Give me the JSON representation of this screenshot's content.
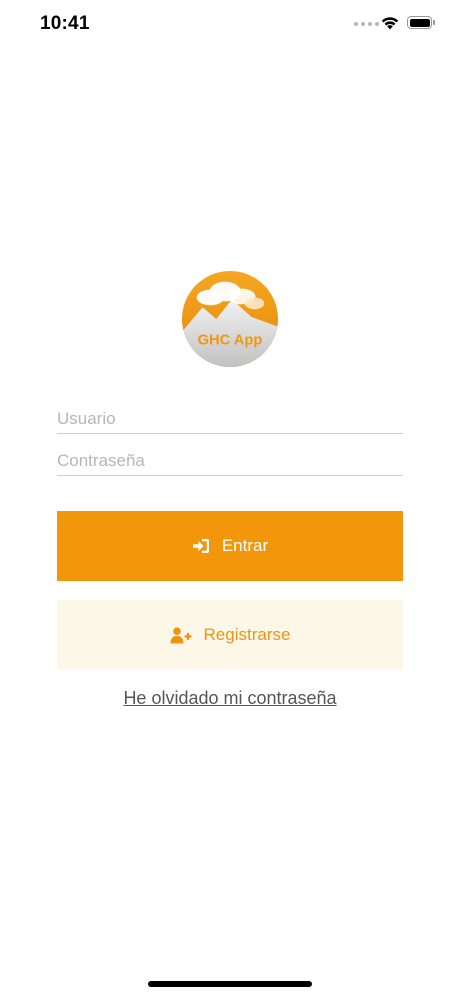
{
  "status_bar": {
    "time": "10:41",
    "signal_icon": "cellular-signal-icon",
    "wifi_icon": "wifi-icon",
    "battery_icon": "battery-icon"
  },
  "logo": {
    "text": "GHC App",
    "colors": {
      "orange": "#f2970c",
      "mountain": "#d9d9d9",
      "cloud": "#ffffff"
    }
  },
  "login_form": {
    "username_placeholder": "Usuario",
    "username_value": "",
    "password_placeholder": "Contraseña",
    "password_value": ""
  },
  "buttons": {
    "login_label": "Entrar",
    "login_icon": "sign-in-icon",
    "register_label": "Registrarse",
    "register_icon": "user-plus-icon",
    "forgot_password_label": "He olvidado mi contraseña"
  },
  "theme": {
    "accent": "#f2970c",
    "accent_light_bg": "#fdf7e8"
  }
}
